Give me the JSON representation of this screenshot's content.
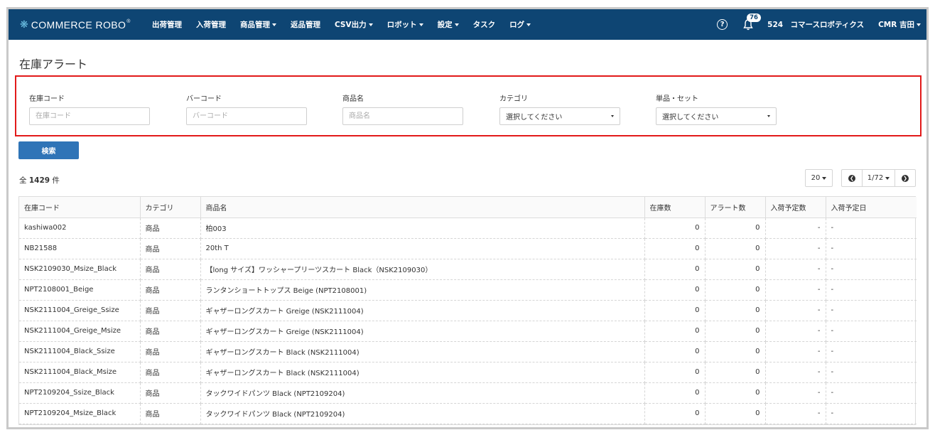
{
  "nav": {
    "logo": "COMMERCE ROBO",
    "logo_sup": "®",
    "menu": [
      {
        "label": "出荷管理",
        "dropdown": false
      },
      {
        "label": "入荷管理",
        "dropdown": false
      },
      {
        "label": "商品管理",
        "dropdown": true
      },
      {
        "label": "返品管理",
        "dropdown": false
      },
      {
        "label": "CSV出力",
        "dropdown": true
      },
      {
        "label": "ロボット",
        "dropdown": true
      },
      {
        "label": "設定",
        "dropdown": true
      },
      {
        "label": "タスク",
        "dropdown": false
      },
      {
        "label": "ログ",
        "dropdown": true
      }
    ],
    "notification_count": "76",
    "company": "524　コマースロボティクス",
    "user": "CMR 吉田"
  },
  "page_title": "在庫アラート",
  "filters": {
    "stock_code": {
      "label": "在庫コード",
      "placeholder": "在庫コード"
    },
    "barcode": {
      "label": "バーコード",
      "placeholder": "バーコード"
    },
    "product_name": {
      "label": "商品名",
      "placeholder": "商品名"
    },
    "category": {
      "label": "カテゴリ",
      "value": "選択してください"
    },
    "type": {
      "label": "単品・セット",
      "value": "選択してください"
    }
  },
  "search_label": "検索",
  "total": {
    "prefix": "全",
    "count": "1429",
    "suffix": "件"
  },
  "pagination": {
    "per_page": "20",
    "page": "1/72"
  },
  "table": {
    "headers": [
      "在庫コード",
      "カテゴリ",
      "商品名",
      "在庫数",
      "アラート数",
      "入荷予定数",
      "入荷予定日"
    ],
    "rows": [
      [
        "kashiwa002",
        "商品",
        "柏003",
        "0",
        "0",
        "-",
        "-"
      ],
      [
        "NB21588",
        "商品",
        "20th T",
        "0",
        "0",
        "-",
        "-"
      ],
      [
        "NSK2109030_Msize_Black",
        "商品",
        "【long サイズ】ワッシャープリーツスカート Black（NSK2109030）",
        "0",
        "0",
        "-",
        "-"
      ],
      [
        "NPT2108001_Beige",
        "商品",
        "ランタンショートトップス Beige (NPT2108001)",
        "0",
        "0",
        "-",
        "-"
      ],
      [
        "NSK2111004_Greige_Ssize",
        "商品",
        "ギャザーロングスカート Greige (NSK2111004)",
        "0",
        "0",
        "-",
        "-"
      ],
      [
        "NSK2111004_Greige_Msize",
        "商品",
        "ギャザーロングスカート Greige (NSK2111004)",
        "0",
        "0",
        "-",
        "-"
      ],
      [
        "NSK2111004_Black_Ssize",
        "商品",
        "ギャザーロングスカート Black (NSK2111004)",
        "0",
        "0",
        "-",
        "-"
      ],
      [
        "NSK2111004_Black_Msize",
        "商品",
        "ギャザーロングスカート Black (NSK2111004)",
        "0",
        "0",
        "-",
        "-"
      ],
      [
        "NPT2109204_Ssize_Black",
        "商品",
        "タックワイドパンツ Black (NPT2109204)",
        "0",
        "0",
        "-",
        "-"
      ],
      [
        "NPT2109204_Msize_Black",
        "商品",
        "タックワイドパンツ Black (NPT2109204)",
        "0",
        "0",
        "-",
        "-"
      ]
    ]
  }
}
